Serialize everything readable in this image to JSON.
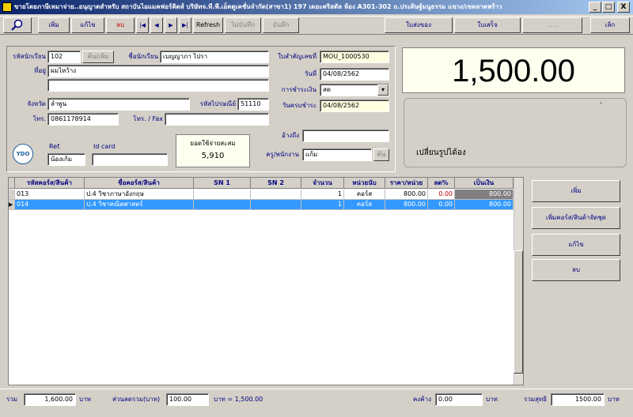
{
  "window": {
    "title": "ขายโดยภาษีเหมาจ่าย..อนุญาตสำหรับ สถาบันไอแมคฟอร์คิดส์ บริษัทจ.ที.พี.เอ็ดดูเคชั่นจำกัด(สาขา1) 197 เดอะคริสตัล ห้อง A301-302 ถ.ประดิษฐ์มนูธรรม แขวง/เขตลาดพร้าว",
    "min": "_",
    "max": "□",
    "close": "X"
  },
  "toolbar": {
    "add": "เพิ่ม",
    "edit": "แก้ไข",
    "delete": "ลบ",
    "first": "|◀",
    "prev": "◀",
    "next": "▶",
    "last": "▶|",
    "refresh": "Refresh",
    "no_save": "ไม่บันทึก",
    "save": "บันทึก",
    "deposit": "ใบส่งของ",
    "receipt": "ใบเสร็จ",
    "blank": "......",
    "exit": "เลิก"
  },
  "customer": {
    "student_id_label": "รหัสนักเรียน",
    "student_id": "102",
    "search_btn": "ค้น/เพิ่ม",
    "student_name_label": "ชื่อนักเรียน",
    "student_name": "เบญญาภา ไปรา",
    "address_label": "ที่อยู่",
    "address1": "ผมไหว้าง",
    "address2": "",
    "province_label": "จังหวัด",
    "province": "ลำพูน",
    "zip_label": "รหัสไปรษณีย์",
    "zip": "51110",
    "phone_label": "โทร.",
    "phone": "0861178914",
    "fax_label": "โทร. / Fax",
    "fax": ""
  },
  "doc": {
    "docno_label": "ใบสำคัญเลขที่",
    "docno": "MOU_1000530",
    "date_label": "วันที่",
    "date": "04/08/2562",
    "payment_label": "การชำระเงิน",
    "payment": "สด",
    "due_label": "วันครบชำระ",
    "due": "04/08/2562",
    "ref_label": "อ้างถึง",
    "ref": "",
    "staff_label": "ครู/พนักงาน",
    "staff": "แก้ม",
    "staff_btn": "ค้น"
  },
  "total_display": "1,500.00",
  "change_text": "เปลี่ยนรูปได้อง",
  "change_dot": "·",
  "idcard": {
    "ref_label": "Ref.",
    "ref_value": "น้องเก้ม",
    "idcard_label": "Id card",
    "idcard_value": "",
    "logo_text": "YDO"
  },
  "accum": {
    "label": "ยอดใช้จ่ายสะสม",
    "value": "5,910"
  },
  "grid": {
    "columns": [
      "รหัสคอร์ส/สินค้า",
      "ชื่อคอร์ส/สินค้า",
      "SN 1",
      "SN 2",
      "จำนวน",
      "หน่วยนับ",
      "ราคา/หน่วย",
      "ลด%",
      "เป็นเงิน"
    ],
    "rows": [
      {
        "marker": "",
        "code": "013",
        "name": "ป.4 วิชาภาษาอังกฤษ",
        "sn1": "",
        "sn2": "",
        "qty": "1",
        "unit": "คอร์ส",
        "price": "800.00",
        "disc": "0.00",
        "amount": "800.00"
      },
      {
        "marker": "▶",
        "code": "014",
        "name": "ป.4 วิชาคณิตศาสตร์",
        "sn1": "",
        "sn2": "",
        "qty": "1",
        "unit": "คอร์ส",
        "price": "800.00",
        "disc": "0.00",
        "amount": "800.00"
      }
    ]
  },
  "side": {
    "add": "เพิ่ม",
    "add_set": "เพิ่มคอร์ส/สินค้าจัดชุด",
    "edit": "แก้ไข",
    "delete": "ลบ"
  },
  "footer": {
    "sum_label": "รวม",
    "sum": "1,600.00",
    "baht1": "บาท",
    "discount_label": "ส่วนลดรวม(บาท)",
    "discount": "100.00",
    "eq": "บาท  =  1,500.00",
    "deposit_label": "คงค้าง",
    "deposit": "0.00",
    "baht2": "บาท",
    "net_label": "รวมสุทธิ",
    "net": "1500.00",
    "baht3": "บาท"
  },
  "colors": {
    "title_start": "#0a246a",
    "title_end": "#a6caf0",
    "selected_row": "#3399ff",
    "amount_cell": "#808080",
    "display_bg": "#fffff0"
  }
}
